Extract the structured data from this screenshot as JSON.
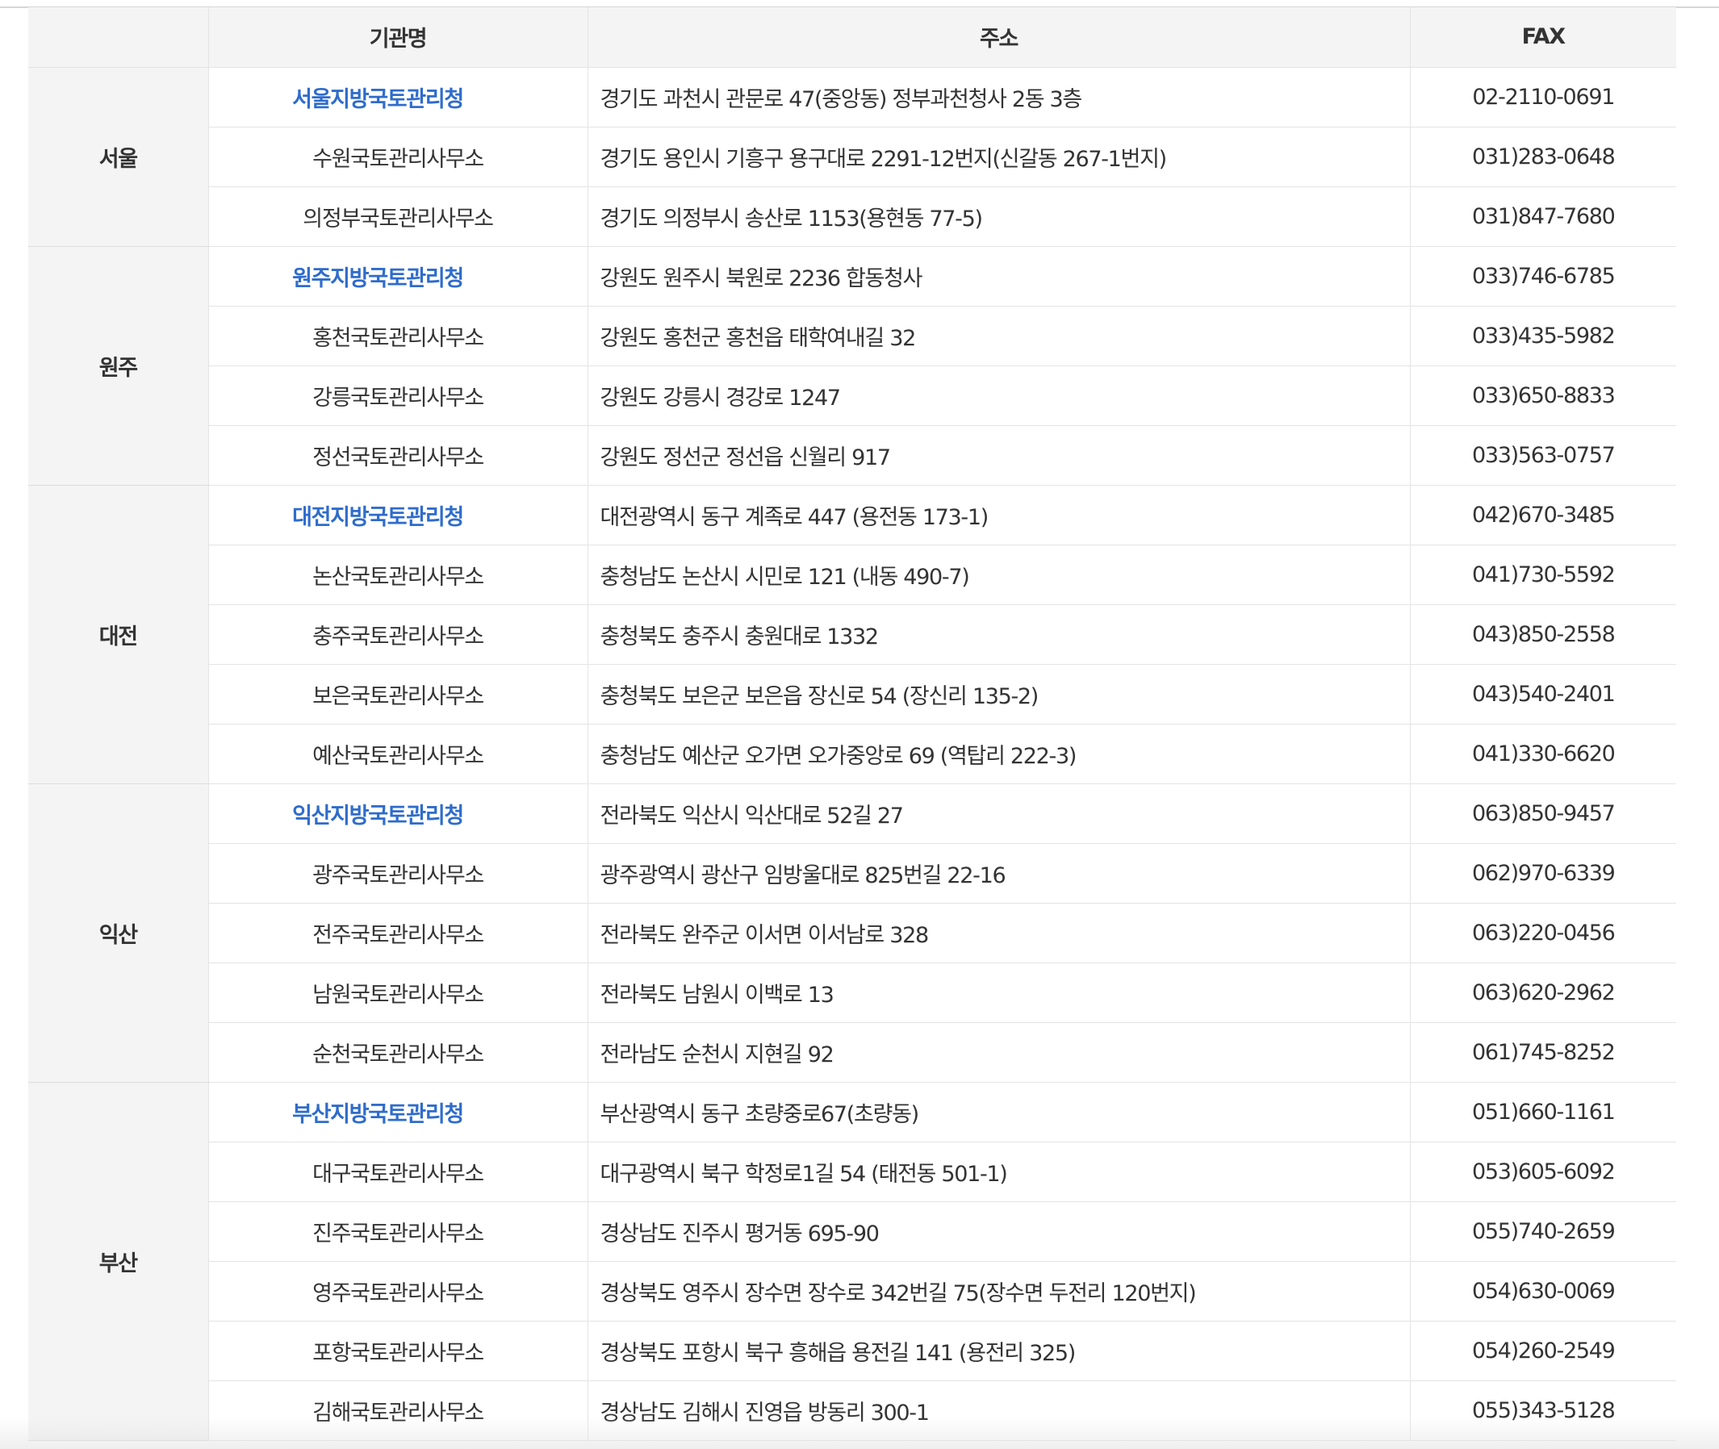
{
  "header": {
    "region": "",
    "name": "기관명",
    "address": "주소",
    "fax": "FAX"
  },
  "accent_color": "#2f6ccb",
  "groups": [
    {
      "region": "서울",
      "rows": [
        {
          "name": "서울지방국토관리청",
          "main": true,
          "address": "경기도 과천시 관문로 47(중앙동) 정부과천청사 2동 3층",
          "fax": "02-2110-0691"
        },
        {
          "name": "수원국토관리사무소",
          "main": false,
          "address": "경기도 용인시 기흥구 용구대로 2291-12번지(신갈동 267-1번지)",
          "fax": "031)283-0648"
        },
        {
          "name": "의정부국토관리사무소",
          "main": false,
          "address": "경기도 의정부시 송산로 1153(용현동 77-5)",
          "fax": "031)847-7680"
        }
      ]
    },
    {
      "region": "원주",
      "rows": [
        {
          "name": "원주지방국토관리청",
          "main": true,
          "address": "강원도 원주시 북원로 2236 합동청사",
          "fax": "033)746-6785"
        },
        {
          "name": "홍천국토관리사무소",
          "main": false,
          "address": "강원도 홍천군 홍천읍 태학여내길 32",
          "fax": "033)435-5982"
        },
        {
          "name": "강릉국토관리사무소",
          "main": false,
          "address": "강원도 강릉시 경강로 1247",
          "fax": "033)650-8833"
        },
        {
          "name": "정선국토관리사무소",
          "main": false,
          "address": "강원도 정선군 정선읍 신월리 917",
          "fax": "033)563-0757"
        }
      ]
    },
    {
      "region": "대전",
      "rows": [
        {
          "name": "대전지방국토관리청",
          "main": true,
          "address": "대전광역시 동구 계족로 447 (용전동 173-1)",
          "fax": "042)670-3485"
        },
        {
          "name": "논산국토관리사무소",
          "main": false,
          "address": "충청남도 논산시 시민로 121 (내동 490-7)",
          "fax": "041)730-5592"
        },
        {
          "name": "충주국토관리사무소",
          "main": false,
          "address": "충청북도 충주시 충원대로 1332",
          "fax": "043)850-2558"
        },
        {
          "name": "보은국토관리사무소",
          "main": false,
          "address": "충청북도 보은군 보은읍 장신로 54 (장신리 135-2)",
          "fax": "043)540-2401"
        },
        {
          "name": "예산국토관리사무소",
          "main": false,
          "address": "충청남도 예산군 오가면 오가중앙로 69 (역탑리 222-3)",
          "fax": "041)330-6620"
        }
      ]
    },
    {
      "region": "익산",
      "rows": [
        {
          "name": "익산지방국토관리청",
          "main": true,
          "address": "전라북도 익산시 익산대로 52길 27",
          "fax": "063)850-9457"
        },
        {
          "name": "광주국토관리사무소",
          "main": false,
          "address": "광주광역시 광산구 임방울대로 825번길 22-16",
          "fax": "062)970-6339"
        },
        {
          "name": "전주국토관리사무소",
          "main": false,
          "address": "전라북도 완주군 이서면 이서남로 328",
          "fax": "063)220-0456"
        },
        {
          "name": "남원국토관리사무소",
          "main": false,
          "address": "전라북도 남원시 이백로 13",
          "fax": "063)620-2962"
        },
        {
          "name": "순천국토관리사무소",
          "main": false,
          "address": "전라남도 순천시 지현길 92",
          "fax": "061)745-8252"
        }
      ]
    },
    {
      "region": "부산",
      "rows": [
        {
          "name": "부산지방국토관리청",
          "main": true,
          "address": "부산광역시 동구 초량중로67(초량동)",
          "fax": "051)660-1161"
        },
        {
          "name": "대구국토관리사무소",
          "main": false,
          "address": "대구광역시 북구 학정로1길 54 (태전동 501-1)",
          "fax": "053)605-6092"
        },
        {
          "name": "진주국토관리사무소",
          "main": false,
          "address": "경상남도 진주시 평거동 695-90",
          "fax": "055)740-2659"
        },
        {
          "name": "영주국토관리사무소",
          "main": false,
          "address": "경상북도 영주시 장수면 장수로 342번길 75(장수면 두전리 120번지)",
          "fax": "054)630-0069"
        },
        {
          "name": "포항국토관리사무소",
          "main": false,
          "address": "경상북도 포항시 북구 흥해읍 용전길 141 (용전리 325)",
          "fax": "054)260-2549"
        },
        {
          "name": "김해국토관리사무소",
          "main": false,
          "address": "경상남도 김해시 진영읍 방동리 300-1",
          "fax": "055)343-5128"
        }
      ]
    }
  ]
}
